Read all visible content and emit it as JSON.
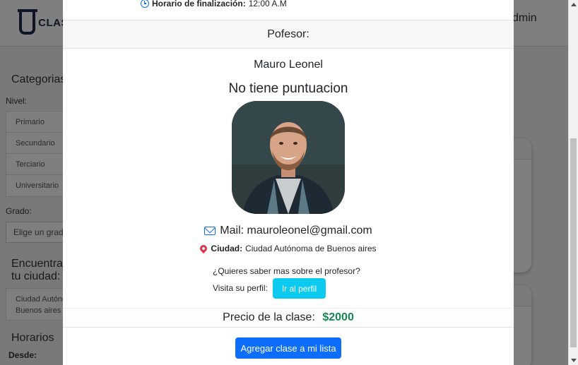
{
  "background": {
    "logo_text": "CLAS",
    "admin_label": "dmin",
    "categories_heading": "Categorias",
    "level_label": "Nivel:",
    "levels": [
      "Primario",
      "Secundario",
      "Terciario",
      "Universitario"
    ],
    "grade_label": "Grado:",
    "grade_placeholder": "Elige un grado",
    "city_heading_line1": "Encuentra",
    "city_heading_line2": "tu ciudad:",
    "city_value_line1": "Ciudad Autónoma",
    "city_value_line2": "Buenos aires",
    "schedule_heading": "Horarios",
    "from_label": "Desde:"
  },
  "modal": {
    "end_time_label": "Horario de finalización:",
    "end_time_value": "12:00 A.M",
    "teacher_section": "Pofesor:",
    "teacher_name": "Mauro Leonel",
    "rating_text": "No tiene puntuacion",
    "mail_text": "Mail: mauroleonel@gmail.com",
    "city_label": "Ciudad:",
    "city_value": "Ciudad Autónoma de Buenos aires",
    "question_text": "¿Quieres saber mas sobre el profesor?",
    "visit_text": "Visita su perfil:",
    "profile_button": "Ir al perfil",
    "price_label": "Precio de la clase:",
    "price_value": "$2000",
    "add_button": "Agregar clase a mi lista"
  },
  "colors": {
    "primary": "#0d6efd",
    "info": "#0dcaf0",
    "success": "#198754",
    "danger": "#dc3545"
  },
  "icons": [
    "clock-icon",
    "mail-icon",
    "map-pin-icon"
  ]
}
